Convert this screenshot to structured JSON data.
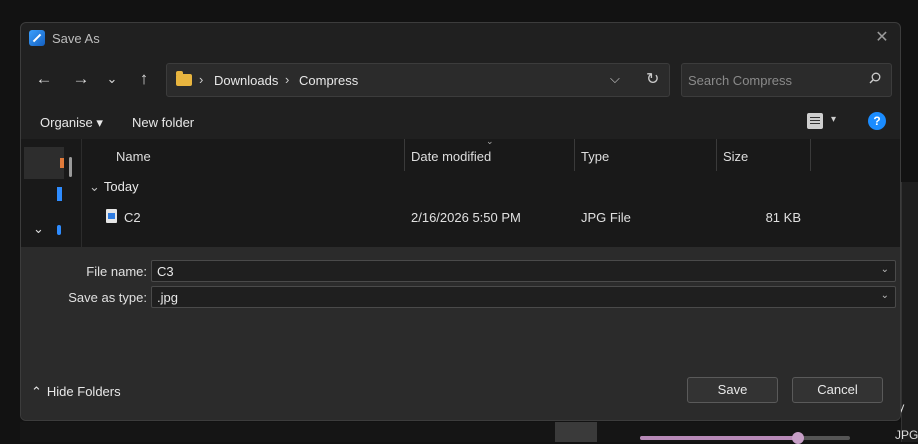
{
  "dialog": {
    "title": "Save As",
    "close_icon": "close-icon"
  },
  "nav": {
    "back_icon": "←",
    "forward_icon": "→",
    "recent_icon": "⌄",
    "up_icon": "↑"
  },
  "address": {
    "breadcrumbs": [
      "Downloads",
      "Compress"
    ],
    "separator": "›"
  },
  "search": {
    "placeholder": "Search Compress"
  },
  "toolbar": {
    "organise_label": "Organise ▾",
    "new_folder_label": "New folder",
    "help_label": "?"
  },
  "columns": {
    "name": "Name",
    "date_modified": "Date modified",
    "type": "Type",
    "size": "Size"
  },
  "group": {
    "label": "Today",
    "chevron": "⌄"
  },
  "files": [
    {
      "name": "C2",
      "date": "2/16/2026 5:50 PM",
      "type": "JPG File",
      "size": "81 KB"
    }
  ],
  "form": {
    "file_name_label": "File name:",
    "file_name_value": "C3",
    "save_type_label": "Save as type:",
    "save_type_value": ".jpg",
    "hide_folders_label": "Hide Folders",
    "save_label": "Save",
    "cancel_label": "Cancel"
  },
  "background": {
    "text_top": "ty",
    "text_bottom": "JPG"
  },
  "colors": {
    "dialog_bg": "#202020",
    "accent": "#1a8cff",
    "folder": "#e8b53f"
  }
}
